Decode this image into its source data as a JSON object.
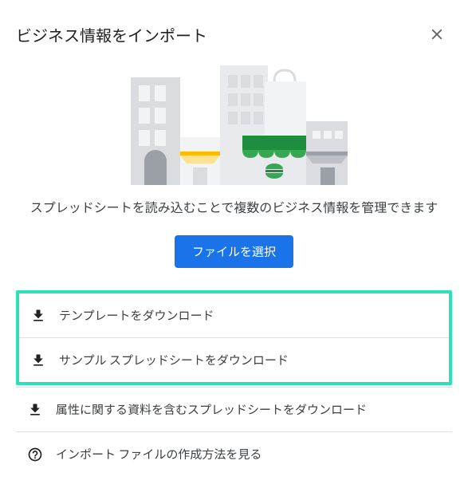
{
  "header": {
    "title": "ビジネス情報をインポート"
  },
  "description": "スプレッドシートを読み込むことで複数のビジネス情報を管理できます",
  "buttons": {
    "select_file": "ファイルを選択"
  },
  "links": {
    "download_template": "テンプレートをダウンロード",
    "download_sample": "サンプル スプレッドシートをダウンロード",
    "download_attributes": "属性に関する資料を含むスプレッドシートをダウンロード",
    "how_to_create": "インポート ファイルの作成方法を見る"
  }
}
